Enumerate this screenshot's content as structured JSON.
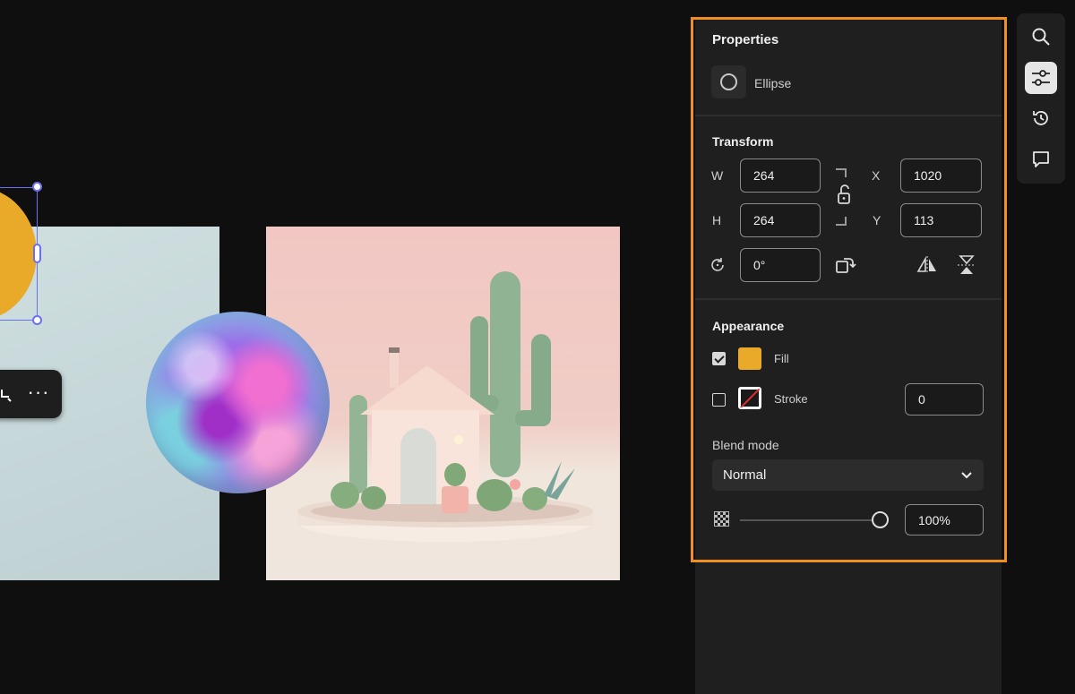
{
  "panel": {
    "title": "Properties",
    "shape_type": "Ellipse",
    "transform": {
      "title": "Transform",
      "w_label": "W",
      "w_value": "264",
      "h_label": "H",
      "h_value": "264",
      "x_label": "X",
      "x_value": "1020",
      "y_label": "Y",
      "y_value": "113",
      "rotation_value": "0°"
    },
    "appearance": {
      "title": "Appearance",
      "fill_label": "Fill",
      "fill_checked": true,
      "fill_color": "#e9aa29",
      "stroke_label": "Stroke",
      "stroke_checked": false,
      "stroke_width": "0",
      "blend_mode_label": "Blend mode",
      "blend_mode_value": "Normal",
      "opacity_value": "100%"
    }
  },
  "rail": {
    "items": [
      "search-icon",
      "properties-sliders-icon",
      "history-icon",
      "comment-icon"
    ],
    "active": "properties-sliders-icon"
  },
  "canvas": {
    "toolbar_more": "···"
  },
  "colors": {
    "highlight": "#f0901c",
    "selection": "#6b6ff0",
    "panel_bg": "#1f1f1f"
  }
}
